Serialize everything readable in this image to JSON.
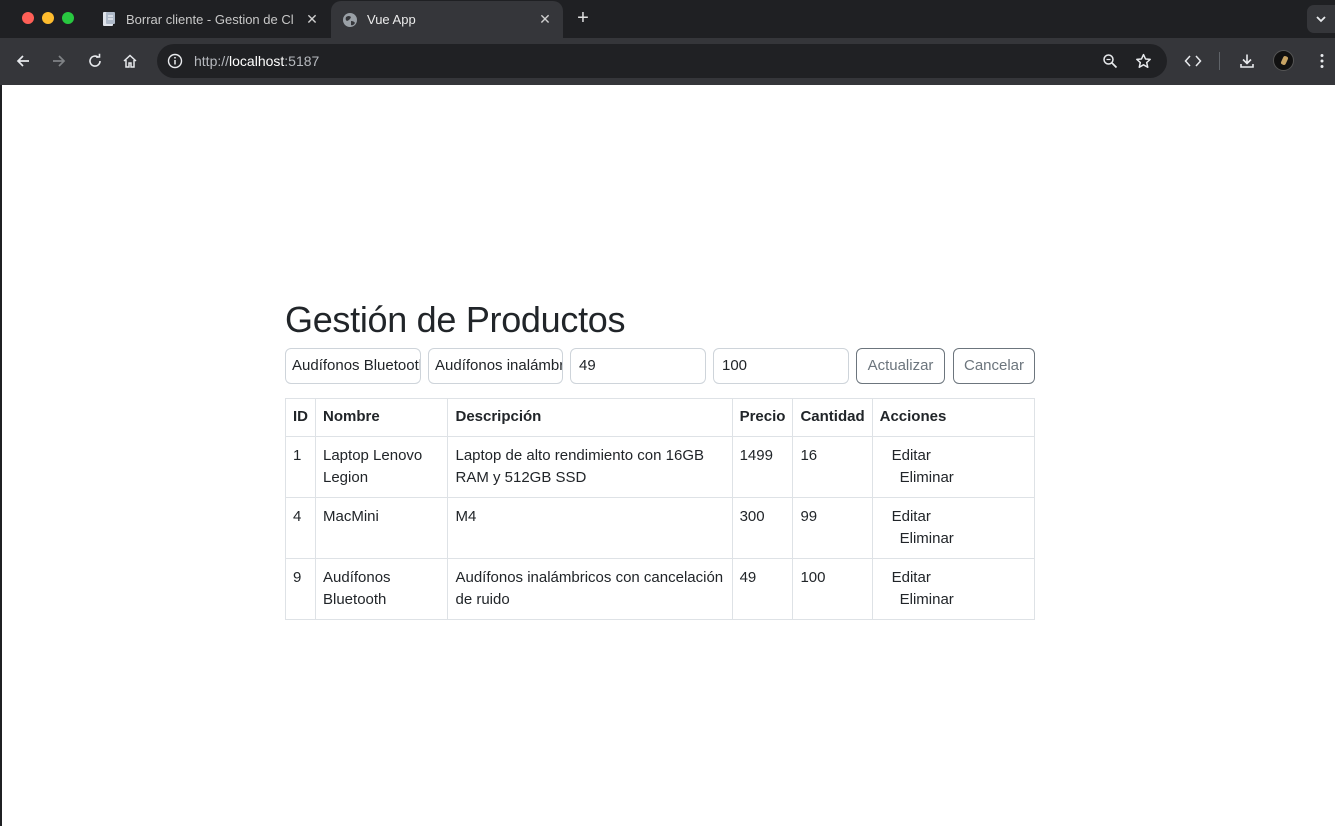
{
  "browser": {
    "tabs": [
      {
        "title": "Borrar cliente - Gestion de Cl",
        "active": false,
        "favicon": "document-icon"
      },
      {
        "title": "Vue App",
        "active": true,
        "favicon": "globe-icon"
      }
    ],
    "url": {
      "scheme": "http://",
      "host": "localhost",
      "port": ":5187"
    }
  },
  "page": {
    "title": "Gestión de Productos",
    "form": {
      "name_value": "Audífonos Bluetooth",
      "description_value": "Audífonos inalámbricos con cancelación de ruido",
      "price_value": "49",
      "quantity_value": "100",
      "update_label": "Actualizar",
      "cancel_label": "Cancelar"
    },
    "table": {
      "headers": {
        "id": "ID",
        "name": "Nombre",
        "description": "Descripción",
        "price": "Precio",
        "quantity": "Cantidad",
        "actions": "Acciones"
      },
      "rows": [
        {
          "id": "1",
          "name": "Laptop Lenovo Legion",
          "description": "Laptop de alto rendimiento con 16GB RAM y 512GB SSD",
          "price": "1499",
          "quantity": "16",
          "edit": "Editar",
          "delete": "Eliminar"
        },
        {
          "id": "4",
          "name": "MacMini",
          "description": "M4",
          "price": "300",
          "quantity": "99",
          "edit": "Editar",
          "delete": "Eliminar"
        },
        {
          "id": "9",
          "name": "Audífonos Bluetooth",
          "description": "Audífonos inalámbricos con cancelación de ruido",
          "price": "49",
          "quantity": "100",
          "edit": "Editar",
          "delete": "Eliminar"
        }
      ]
    }
  }
}
